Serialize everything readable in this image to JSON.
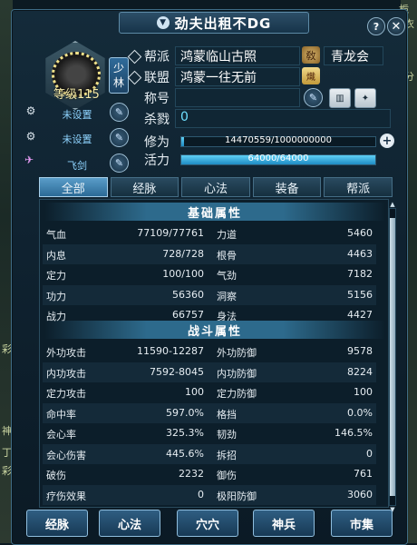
{
  "window": {
    "title": "劲夫出租不DG",
    "help_label": "?",
    "close_label": "✕"
  },
  "edge": {
    "left_labels": [
      "彩",
      "神",
      "丁",
      "彩"
    ],
    "right_top": "栀子",
    "right_2": "衣",
    "right_3": "分"
  },
  "profile": {
    "level": "等级115",
    "sect": "少林",
    "guild_label": "帮派",
    "guild_value": "鸿蒙临山古照",
    "alliance_label": "联盟",
    "alliance_value": "鸿蒙一往无前",
    "badge_1": "敎",
    "badge_1_value": "青龙会",
    "badge_2": "熾",
    "title_label": "称号",
    "title_value": "",
    "kills_label": "杀戮",
    "kills_value": "0",
    "cultivation_label": "修为",
    "cultivation_value": "14470559/1000000000",
    "cultivation_fraction": 0.0145,
    "vitality_label": "活力",
    "vitality_value": "64000/64000",
    "vitality_fraction": 1.0
  },
  "slots": [
    {
      "icon": "mount-icon",
      "value": "未设置"
    },
    {
      "icon": "mount-icon",
      "value": "未设置"
    },
    {
      "icon": "flying-sword-icon",
      "value": "飞剑"
    }
  ],
  "tabs": [
    {
      "label": "全部",
      "active": true
    },
    {
      "label": "经脉",
      "active": false
    },
    {
      "label": "心法",
      "active": false
    },
    {
      "label": "装备",
      "active": false
    },
    {
      "label": "帮派",
      "active": false
    }
  ],
  "basic": {
    "header": "基础属性",
    "rows": [
      [
        "气血",
        "77109/77761",
        "力道",
        "5460"
      ],
      [
        "内息",
        "728/728",
        "根骨",
        "4463"
      ],
      [
        "定力",
        "100/100",
        "气劲",
        "7182"
      ],
      [
        "功力",
        "56360",
        "洞察",
        "5156"
      ],
      [
        "战力",
        "66757",
        "身法",
        "4427"
      ]
    ]
  },
  "combat": {
    "header": "战斗属性",
    "rows": [
      [
        "外功攻击",
        "11590-12287",
        "外功防御",
        "9578"
      ],
      [
        "内功攻击",
        "7592-8045",
        "内功防御",
        "8224"
      ],
      [
        "定力攻击",
        "100",
        "定力防御",
        "100"
      ],
      [
        "命中率",
        "597.0%",
        "格挡",
        "0.0%"
      ],
      [
        "会心率",
        "325.3%",
        "韧劲",
        "146.5%"
      ],
      [
        "会心伤害",
        "445.6%",
        "拆招",
        "0"
      ],
      [
        "破伤",
        "2232",
        "御伤",
        "761"
      ],
      [
        "疗伤效果",
        "0",
        "极阳防御",
        "3060"
      ]
    ]
  },
  "bottom_buttons": [
    "经脉",
    "心法",
    "穴穴",
    "神兵",
    "市集"
  ]
}
